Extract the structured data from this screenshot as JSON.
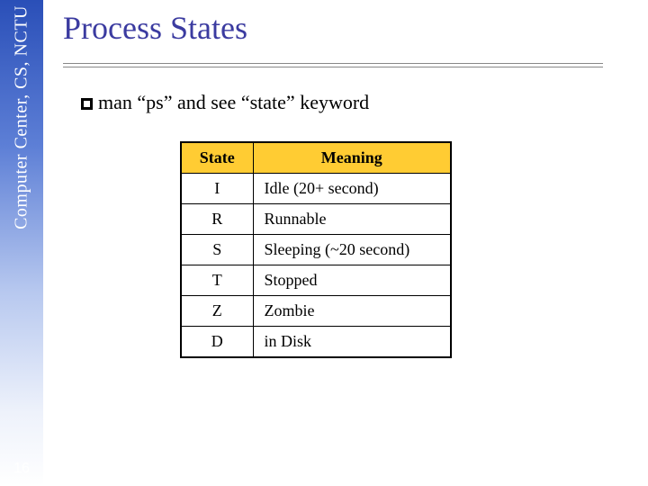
{
  "sidebar": {
    "org_text": "Computer Center, CS, NCTU",
    "page_number": "16"
  },
  "title": "Process States",
  "bullet": {
    "prefix": "man “ps” and see ",
    "quoted": "“state”",
    "suffix": " keyword"
  },
  "table": {
    "headers": {
      "state": "State",
      "meaning": "Meaning"
    },
    "rows": [
      {
        "state": "I",
        "meaning": "Idle (20+ second)"
      },
      {
        "state": "R",
        "meaning": "Runnable"
      },
      {
        "state": "S",
        "meaning": "Sleeping (~20 second)"
      },
      {
        "state": "T",
        "meaning": "Stopped"
      },
      {
        "state": "Z",
        "meaning": "Zombie"
      },
      {
        "state": "D",
        "meaning": "in Disk"
      }
    ]
  }
}
